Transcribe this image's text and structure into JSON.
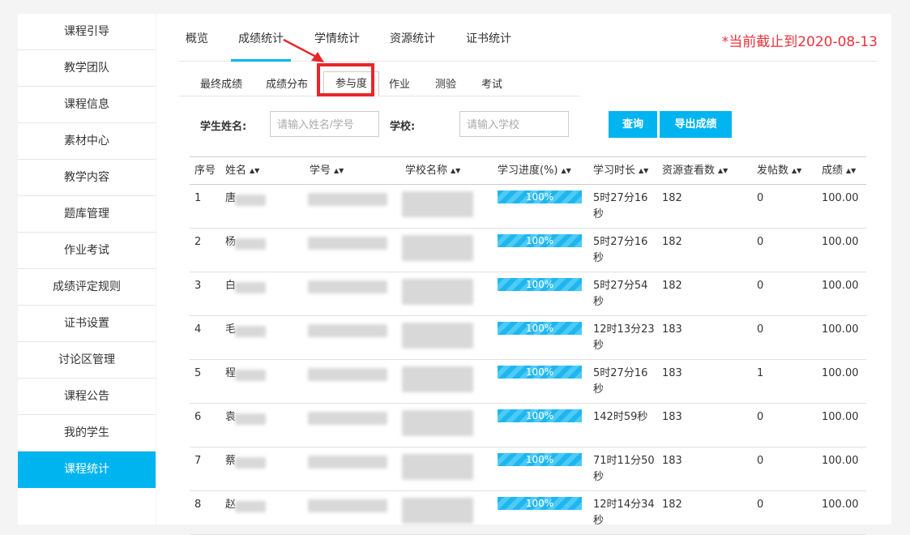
{
  "sidebar": {
    "items": [
      {
        "label": "课程引导"
      },
      {
        "label": "教学团队"
      },
      {
        "label": "课程信息"
      },
      {
        "label": "素材中心"
      },
      {
        "label": "教学内容"
      },
      {
        "label": "题库管理"
      },
      {
        "label": "作业考试"
      },
      {
        "label": "成绩评定规则"
      },
      {
        "label": "证书设置"
      },
      {
        "label": "讨论区管理"
      },
      {
        "label": "课程公告"
      },
      {
        "label": "我的学生"
      },
      {
        "label": "课程统计"
      }
    ],
    "active_index": 12
  },
  "top_tabs": [
    {
      "label": "概览"
    },
    {
      "label": "成绩统计"
    },
    {
      "label": "学情统计"
    },
    {
      "label": "资源统计"
    },
    {
      "label": "证书统计"
    }
  ],
  "date_note": "*当前截止到2020-08-13",
  "sub_tabs": [
    {
      "label": "最终成绩"
    },
    {
      "label": "成绩分布"
    },
    {
      "label": "参与度"
    },
    {
      "label": "作业"
    },
    {
      "label": "测验"
    },
    {
      "label": "考试"
    }
  ],
  "filters": {
    "name_label": "学生姓名:",
    "name_placeholder": "请输入姓名/学号",
    "school_label": "学校:",
    "school_placeholder": "请输入学校",
    "query_button": "查询",
    "export_button": "导出成绩"
  },
  "table": {
    "headers": [
      "序号",
      "姓名",
      "学号",
      "学校名称",
      "学习进度(%)",
      "学习时长",
      "资源查看数",
      "发帖数",
      "成绩"
    ],
    "rows": [
      {
        "idx": "1",
        "name": "唐",
        "progress": "100%",
        "duration": "5时27分16秒",
        "resources": "182",
        "posts": "0",
        "score": "100.00"
      },
      {
        "idx": "2",
        "name": "杨",
        "progress": "100%",
        "duration": "5时27分16秒",
        "resources": "182",
        "posts": "0",
        "score": "100.00"
      },
      {
        "idx": "3",
        "name": "白",
        "progress": "100%",
        "duration": "5时27分54秒",
        "resources": "182",
        "posts": "0",
        "score": "100.00"
      },
      {
        "idx": "4",
        "name": "毛",
        "progress": "100%",
        "duration": "12时13分23秒",
        "resources": "183",
        "posts": "0",
        "score": "100.00"
      },
      {
        "idx": "5",
        "name": "程",
        "progress": "100%",
        "duration": "5时27分16秒",
        "resources": "183",
        "posts": "1",
        "score": "100.00"
      },
      {
        "idx": "6",
        "name": "袁",
        "progress": "100%",
        "duration": "142时59秒",
        "resources": "183",
        "posts": "0",
        "score": "100.00"
      },
      {
        "idx": "7",
        "name": "蔡",
        "progress": "100%",
        "duration": "71时11分50秒",
        "resources": "183",
        "posts": "0",
        "score": "100.00"
      },
      {
        "idx": "8",
        "name": "赵",
        "progress": "100%",
        "duration": "12时14分34秒",
        "resources": "182",
        "posts": "0",
        "score": "100.00"
      }
    ]
  },
  "colors": {
    "accent": "#00b4f0",
    "highlight": "#e8262a",
    "date_note": "#e8323c"
  }
}
